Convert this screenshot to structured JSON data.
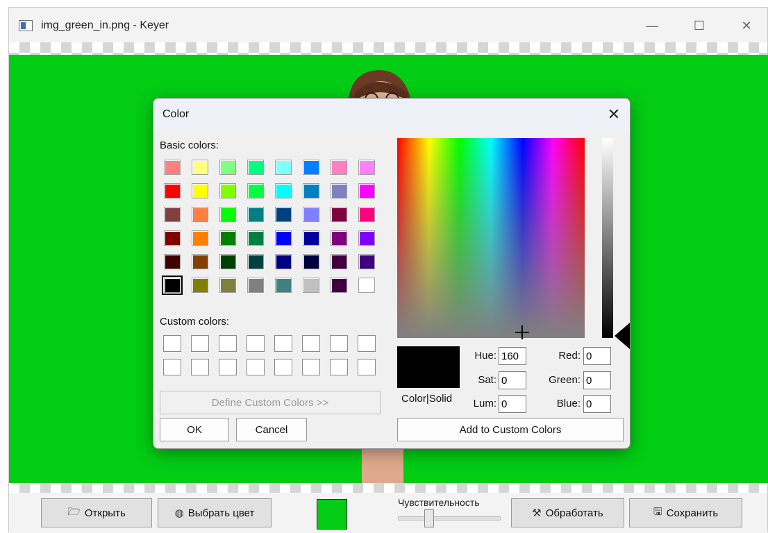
{
  "window": {
    "title": "img_green_in.png - Keyer",
    "minimize_glyph": "—",
    "maximize_glyph": "☐",
    "close_glyph": "✕"
  },
  "dialog": {
    "title": "Color",
    "close_glyph": "✕",
    "basic_colors_label": "Basic colors:",
    "custom_colors_label": "Custom colors:",
    "basic_colors": [
      [
        "#ff8080",
        "#ffff80",
        "#80ff80",
        "#00ff80",
        "#80ffff",
        "#0080ff",
        "#ff80c0",
        "#ff80ff"
      ],
      [
        "#ff0000",
        "#ffff00",
        "#80ff00",
        "#00ff40",
        "#00ffff",
        "#0080c0",
        "#8080c0",
        "#ff00ff"
      ],
      [
        "#804040",
        "#ff8040",
        "#00ff00",
        "#008080",
        "#004080",
        "#8080ff",
        "#800040",
        "#ff0080"
      ],
      [
        "#800000",
        "#ff8000",
        "#008000",
        "#008040",
        "#0000ff",
        "#0000a0",
        "#800080",
        "#8000ff"
      ],
      [
        "#400000",
        "#804000",
        "#004000",
        "#004040",
        "#000080",
        "#000040",
        "#400040",
        "#400080"
      ],
      [
        "#000000",
        "#808000",
        "#808040",
        "#808080",
        "#408080",
        "#c0c0c0",
        "#400040",
        "#ffffff"
      ]
    ],
    "selected_basic_index": [
      5,
      0
    ],
    "custom_colors_count": 16,
    "define_custom_label": "Define Custom Colors >>",
    "ok_label": "OK",
    "cancel_label": "Cancel",
    "add_custom_label": "Add to Custom Colors",
    "color_solid_label": "Color|Solid",
    "current_color": "#000000",
    "fields": {
      "hue_label": "Hue:",
      "hue_value": "160",
      "sat_label": "Sat:",
      "sat_value": "0",
      "lum_label": "Lum:",
      "lum_value": "0",
      "red_label": "Red:",
      "red_value": "0",
      "green_label": "Green:",
      "green_value": "0",
      "blue_label": "Blue:",
      "blue_value": "0"
    }
  },
  "toolbar": {
    "open_label": "Открыть",
    "open_icon": "folder-icon",
    "pick_color_label": "Выбрать цвет",
    "pick_color_icon": "palette-icon",
    "key_color": "#02cc14",
    "sensitivity_label": "Чувствительность",
    "process_label": "Обработать",
    "process_icon": "tools-icon",
    "save_label": "Сохранить",
    "save_icon": "floppy-icon"
  }
}
